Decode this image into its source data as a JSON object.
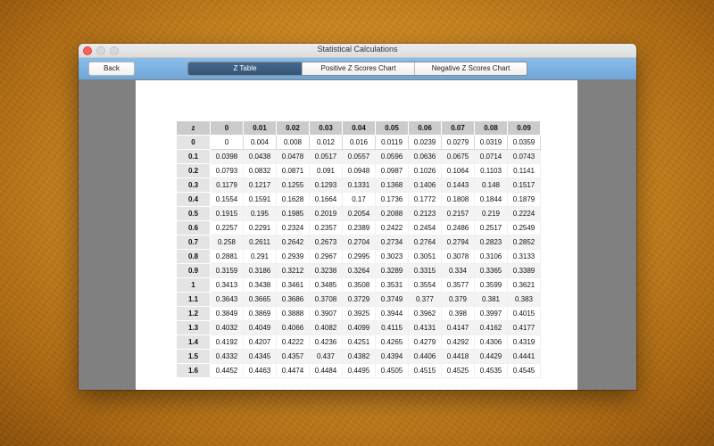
{
  "window": {
    "title": "Statistical Calculations"
  },
  "toolbar": {
    "back_label": "Back",
    "tabs": [
      {
        "label": "Z Table",
        "active": true
      },
      {
        "label": "Positive Z Scores Chart",
        "active": false
      },
      {
        "label": "Negative Z Scores Chart",
        "active": false
      }
    ]
  },
  "ztable": {
    "corner": "z",
    "columns": [
      "0",
      "0.01",
      "0.02",
      "0.03",
      "0.04",
      "0.05",
      "0.06",
      "0.07",
      "0.08",
      "0.09"
    ],
    "rows": [
      {
        "z": "0",
        "values": [
          "0",
          "0.004",
          "0.008",
          "0.012",
          "0.016",
          "0.0119",
          "0.0239",
          "0.0279",
          "0.0319",
          "0.0359"
        ]
      },
      {
        "z": "0.1",
        "values": [
          "0.0398",
          "0.0438",
          "0.0478",
          "0.0517",
          "0.0557",
          "0.0596",
          "0.0636",
          "0.0675",
          "0.0714",
          "0.0743"
        ]
      },
      {
        "z": "0.2",
        "values": [
          "0.0793",
          "0.0832",
          "0.0871",
          "0.091",
          "0.0948",
          "0.0987",
          "0.1026",
          "0.1064",
          "0.1103",
          "0.1141"
        ]
      },
      {
        "z": "0.3",
        "values": [
          "0.1179",
          "0.1217",
          "0.1255",
          "0.1293",
          "0.1331",
          "0.1368",
          "0.1406",
          "0.1443",
          "0.148",
          "0.1517"
        ]
      },
      {
        "z": "0.4",
        "values": [
          "0.1554",
          "0.1591",
          "0.1628",
          "0.1664",
          "0.17",
          "0.1736",
          "0.1772",
          "0.1808",
          "0.1844",
          "0.1879"
        ]
      },
      {
        "z": "0.5",
        "values": [
          "0.1915",
          "0.195",
          "0.1985",
          "0.2019",
          "0.2054",
          "0.2088",
          "0.2123",
          "0.2157",
          "0.219",
          "0.2224"
        ]
      },
      {
        "z": "0.6",
        "values": [
          "0.2257",
          "0.2291",
          "0.2324",
          "0.2357",
          "0.2389",
          "0.2422",
          "0.2454",
          "0.2486",
          "0.2517",
          "0.2549"
        ]
      },
      {
        "z": "0.7",
        "values": [
          "0.258",
          "0.2611",
          "0.2642",
          "0.2673",
          "0.2704",
          "0.2734",
          "0.2764",
          "0.2794",
          "0.2823",
          "0.2852"
        ]
      },
      {
        "z": "0.8",
        "values": [
          "0.2881",
          "0.291",
          "0.2939",
          "0.2967",
          "0.2995",
          "0.3023",
          "0.3051",
          "0.3078",
          "0.3106",
          "0.3133"
        ]
      },
      {
        "z": "0.9",
        "values": [
          "0.3159",
          "0.3186",
          "0.3212",
          "0.3238",
          "0.3264",
          "0.3289",
          "0.3315",
          "0.334",
          "0.3365",
          "0.3389"
        ]
      },
      {
        "z": "1",
        "values": [
          "0.3413",
          "0.3438",
          "0.3461",
          "0.3485",
          "0.3508",
          "0.3531",
          "0.3554",
          "0.3577",
          "0.3599",
          "0.3621"
        ]
      },
      {
        "z": "1.1",
        "values": [
          "0.3643",
          "0.3665",
          "0.3686",
          "0.3708",
          "0.3729",
          "0.3749",
          "0.377",
          "0.379",
          "0.381",
          "0.383"
        ]
      },
      {
        "z": "1.2",
        "values": [
          "0.3849",
          "0.3869",
          "0.3888",
          "0.3907",
          "0.3925",
          "0.3944",
          "0.3962",
          "0.398",
          "0.3997",
          "0.4015"
        ]
      },
      {
        "z": "1.3",
        "values": [
          "0.4032",
          "0.4049",
          "0.4066",
          "0.4082",
          "0.4099",
          "0.4115",
          "0.4131",
          "0.4147",
          "0.4162",
          "0.4177"
        ]
      },
      {
        "z": "1.4",
        "values": [
          "0.4192",
          "0.4207",
          "0.4222",
          "0.4236",
          "0.4251",
          "0.4265",
          "0.4279",
          "0.4292",
          "0.4306",
          "0.4319"
        ]
      },
      {
        "z": "1.5",
        "values": [
          "0.4332",
          "0.4345",
          "0.4357",
          "0.437",
          "0.4382",
          "0.4394",
          "0.4406",
          "0.4418",
          "0.4429",
          "0.4441"
        ]
      },
      {
        "z": "1.6",
        "values": [
          "0.4452",
          "0.4463",
          "0.4474",
          "0.4484",
          "0.4495",
          "0.4505",
          "0.4515",
          "0.4525",
          "0.4535",
          "0.4545"
        ]
      }
    ]
  }
}
